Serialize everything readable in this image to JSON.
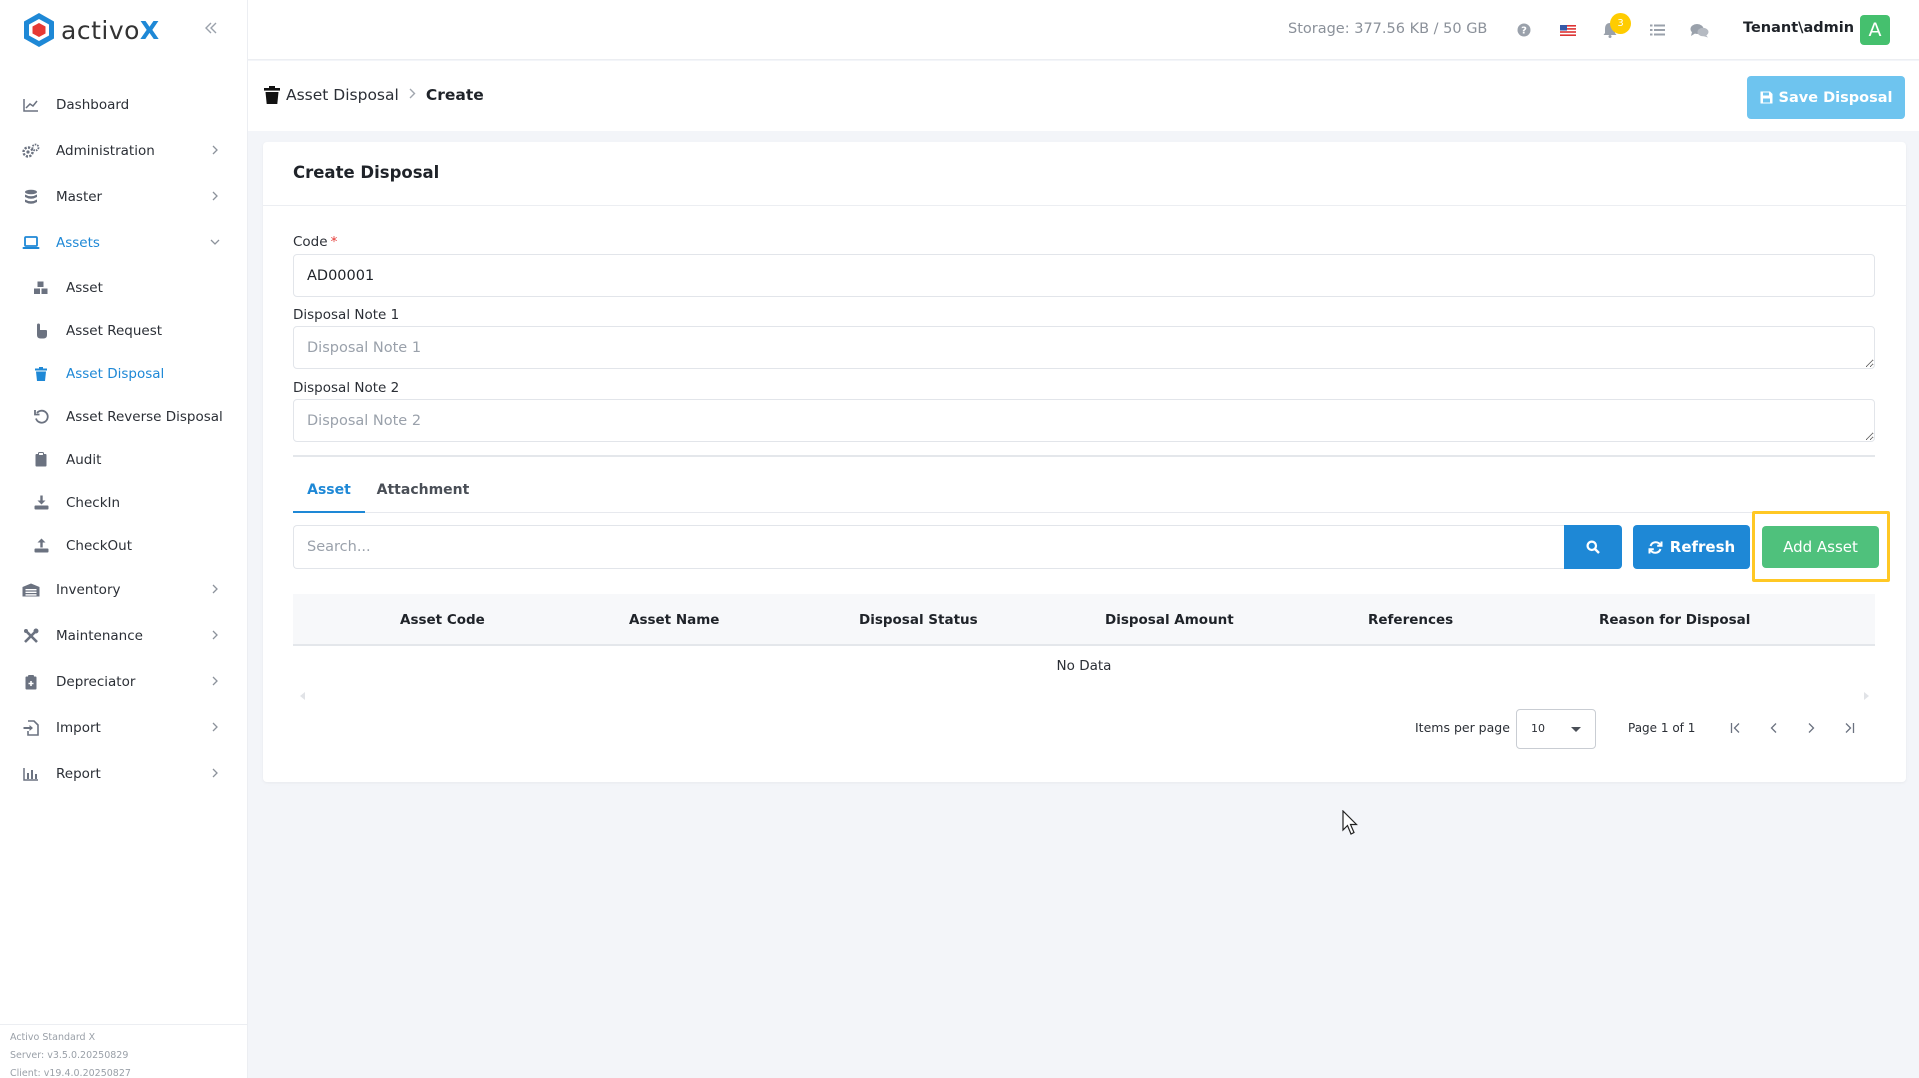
{
  "brand": {
    "name_prefix": "activo",
    "name_suffix": "X"
  },
  "sidebar": {
    "items": [
      {
        "label": "Dashboard",
        "icon": "chart-line-icon"
      },
      {
        "label": "Administration",
        "icon": "gears-icon"
      },
      {
        "label": "Master",
        "icon": "database-icon"
      },
      {
        "label": "Assets",
        "icon": "laptop-icon",
        "expanded": true
      },
      {
        "label": "Inventory",
        "icon": "warehouse-icon"
      },
      {
        "label": "Maintenance",
        "icon": "tools-icon"
      },
      {
        "label": "Depreciator",
        "icon": "calculator-icon"
      },
      {
        "label": "Import",
        "icon": "file-import-icon"
      },
      {
        "label": "Report",
        "icon": "bar-chart-icon"
      }
    ],
    "sub_items": [
      {
        "label": "Asset",
        "icon": "cubes-icon"
      },
      {
        "label": "Asset Request",
        "icon": "hand-pointer-icon"
      },
      {
        "label": "Asset Disposal",
        "icon": "trash-icon",
        "active": true
      },
      {
        "label": "Asset Reverse Disposal",
        "icon": "undo-icon"
      },
      {
        "label": "Audit",
        "icon": "clipboard-icon"
      },
      {
        "label": "CheckIn",
        "icon": "download-icon"
      },
      {
        "label": "CheckOut",
        "icon": "upload-icon"
      }
    ],
    "footer": {
      "product": "Activo Standard X",
      "server": "Server: v3.5.0.20250829",
      "client": "Client: v19.4.0.20250827"
    }
  },
  "topbar": {
    "storage": "Storage: 377.56 KB / 50 GB",
    "notification_count": "3",
    "user": "Tenant\\admin",
    "avatar_letter": "A"
  },
  "breadcrumb": {
    "parent": "Asset Disposal",
    "current": "Create"
  },
  "actions": {
    "save_label": "Save Disposal"
  },
  "form": {
    "title": "Create Disposal",
    "code_label": "Code",
    "code_value": "AD00001",
    "note1_label": "Disposal Note 1",
    "note1_placeholder": "Disposal Note 1",
    "note2_label": "Disposal Note 2",
    "note2_placeholder": "Disposal Note 2"
  },
  "tabs": [
    {
      "label": "Asset",
      "active": true
    },
    {
      "label": "Attachment"
    }
  ],
  "toolbar": {
    "search_placeholder": "Search...",
    "refresh_label": "Refresh",
    "add_label": "Add Asset"
  },
  "table": {
    "columns": [
      "Asset Code",
      "Asset Name",
      "Disposal Status",
      "Disposal Amount",
      "References",
      "Reason for Disposal"
    ],
    "empty_text": "No Data"
  },
  "pager": {
    "items_label": "Items per page",
    "page_size": "10",
    "page_info": "Page 1 of 1"
  },
  "colors": {
    "primary": "#1e88d6",
    "success": "#4fc17c",
    "highlight": "#ffc824",
    "save_disabled": "#6ec4ef"
  }
}
